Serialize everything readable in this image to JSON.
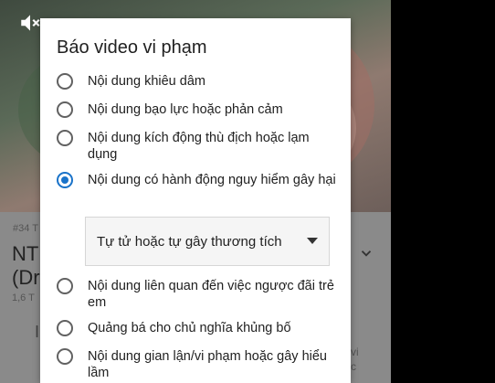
{
  "background": {
    "rank_text": "#34 T",
    "title_line1": "NTI",
    "title_line2": "(Dro",
    "views_text": "1,6 T",
    "misc1": "I",
    "misc2": "vi",
    "misc3": "c"
  },
  "dialog": {
    "title": "Báo video vi phạm",
    "options": [
      {
        "label": "Nội dung khiêu dâm",
        "checked": false
      },
      {
        "label": "Nội dung bạo lực hoặc phản cảm",
        "checked": false
      },
      {
        "label": "Nội dung kích động thù địch hoặc lạm dụng",
        "checked": false
      },
      {
        "label": "Nội dung có hành động nguy hiểm gây hại",
        "checked": true
      },
      {
        "label": "Nội dung liên quan đến việc ngược đãi trẻ em",
        "checked": false
      },
      {
        "label": "Quảng bá cho chủ nghĩa khủng bố",
        "checked": false
      },
      {
        "label": "Nội dung gian lận/vi phạm hoặc gây hiểu lầm",
        "checked": false
      }
    ],
    "subcategory_select": {
      "selected": "Tự tử hoặc tự gây thương tích"
    }
  },
  "colors": {
    "accent": "#1a73c9",
    "dialog_bg": "#ffffff",
    "overlay": "#000000"
  }
}
